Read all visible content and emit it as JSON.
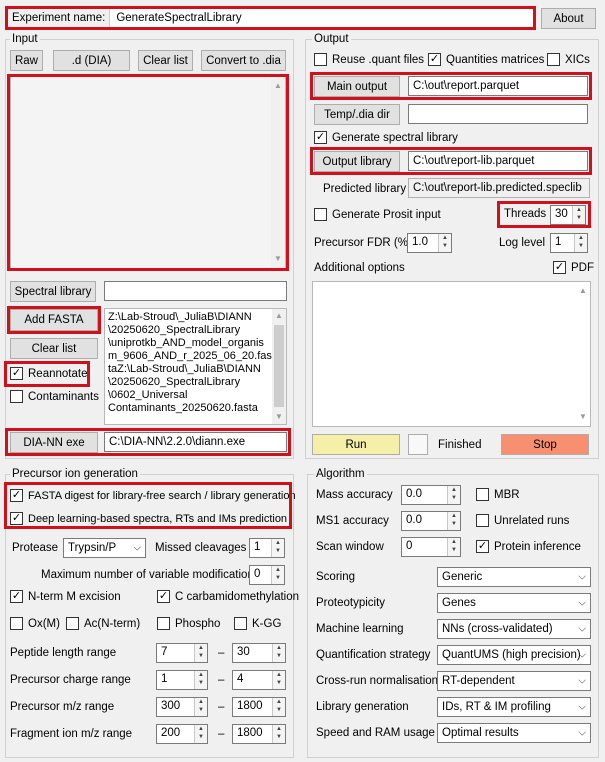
{
  "header": {
    "experiment_label": "Experiment name:",
    "experiment_value": "GenerateSpectralLibrary",
    "about_label": "About"
  },
  "input": {
    "title": "Input",
    "raw_label": "Raw",
    "d_dia_label": ".d (DIA)",
    "clear_list_label": "Clear list",
    "convert_label": "Convert to .dia",
    "spectral_library_label": "Spectral library",
    "spectral_library_value": "",
    "add_fasta_label": "Add FASTA",
    "clear_list2_label": "Clear list",
    "reannotate_label": "Reannotate",
    "reannotate_checked": true,
    "contaminants_label": "Contaminants",
    "contaminants_checked": false,
    "fasta_lines": [
      "Z:\\Lab-Stroud\\_JuliaB\\DIANN",
      "\\20250620_SpectralLibrary",
      "\\uniprotkb_AND_model_organis",
      "m_9606_AND_r_2025_06_20.fas",
      "taZ:\\Lab-Stroud\\_JuliaB\\DIANN",
      "\\20250620_SpectralLibrary",
      "\\0602_Universal",
      "Contaminants_20250620.fasta"
    ],
    "diann_exe_label": "DIA-NN exe",
    "diann_exe_value": "C:\\DIA-NN\\2.2.0\\diann.exe"
  },
  "output": {
    "title": "Output",
    "reuse_quant_label": "Reuse .quant files",
    "reuse_quant_checked": false,
    "quant_matrices_label": "Quantities matrices",
    "quant_matrices_checked": true,
    "xics_label": "XICs",
    "xics_checked": false,
    "main_output_label": "Main output",
    "main_output_value": "C:\\out\\report.parquet",
    "temp_dir_label": "Temp/.dia dir",
    "temp_dir_value": "",
    "gen_lib_label": "Generate spectral library",
    "gen_lib_checked": true,
    "output_library_label": "Output library",
    "output_library_value": "C:\\out\\report-lib.parquet",
    "predicted_library_label": "Predicted library",
    "predicted_library_value": "C:\\out\\report-lib.predicted.speclib",
    "prosit_label": "Generate Prosit input",
    "prosit_checked": false,
    "threads_label": "Threads",
    "threads_value": "30",
    "fdr_label": "Precursor FDR (%)",
    "fdr_value": "1.0",
    "log_level_label": "Log level",
    "log_level_value": "1",
    "additional_label": "Additional options",
    "pdf_label": "PDF",
    "pdf_checked": true,
    "run_label": "Run",
    "finished_label": "Finished",
    "stop_label": "Stop"
  },
  "precursor": {
    "title": "Precursor ion generation",
    "fasta_digest_label": "FASTA digest for library-free search / library generation",
    "fasta_digest_checked": true,
    "deep_learning_label": "Deep learning-based spectra, RTs and IMs prediction",
    "deep_learning_checked": true,
    "protease_label": "Protease",
    "protease_value": "Trypsin/P",
    "missed_label": "Missed cleavages",
    "missed_value": "1",
    "max_var_label": "Maximum number of variable modifications",
    "max_var_value": "0",
    "nterm_label": "N-term M excision",
    "nterm_checked": true,
    "carbam_label": "C carbamidomethylation",
    "carbam_checked": true,
    "oxm_label": "Ox(M)",
    "oxm_checked": false,
    "acn_label": "Ac(N-term)",
    "acn_checked": false,
    "phospho_label": "Phospho",
    "phospho_checked": false,
    "kgg_label": "K-GG",
    "kgg_checked": false,
    "dash": "–",
    "pep_len_label": "Peptide length range",
    "pep_len_min": "7",
    "pep_len_max": "30",
    "charge_label": "Precursor charge range",
    "charge_min": "1",
    "charge_max": "4",
    "prec_mz_label": "Precursor m/z range",
    "prec_mz_min": "300",
    "prec_mz_max": "1800",
    "frag_mz_label": "Fragment ion m/z range",
    "frag_mz_min": "200",
    "frag_mz_max": "1800"
  },
  "algorithm": {
    "title": "Algorithm",
    "mass_acc_label": "Mass accuracy",
    "mass_acc_value": "0.0",
    "ms1_acc_label": "MS1 accuracy",
    "ms1_acc_value": "0.0",
    "scan_window_label": "Scan window",
    "scan_window_value": "0",
    "mbr_label": "MBR",
    "mbr_checked": false,
    "unrelated_label": "Unrelated runs",
    "unrelated_checked": false,
    "protein_inf_label": "Protein inference",
    "protein_inf_checked": true,
    "scoring_label": "Scoring",
    "scoring_value": "Generic",
    "proteotypicity_label": "Proteotypicity",
    "proteotypicity_value": "Genes",
    "ml_label": "Machine learning",
    "ml_value": "NNs (cross-validated)",
    "quant_label": "Quantification strategy",
    "quant_value": "QuantUMS (high precision)",
    "norm_label": "Cross-run normalisation",
    "norm_value": "RT-dependent",
    "libgen_label": "Library generation",
    "libgen_value": "IDs, RT & IM profiling",
    "speed_label": "Speed and RAM usage",
    "speed_value": "Optimal results"
  },
  "colors": {
    "highlight": "#d0101a",
    "run": "#f5f0a8",
    "stop": "#f89070"
  }
}
